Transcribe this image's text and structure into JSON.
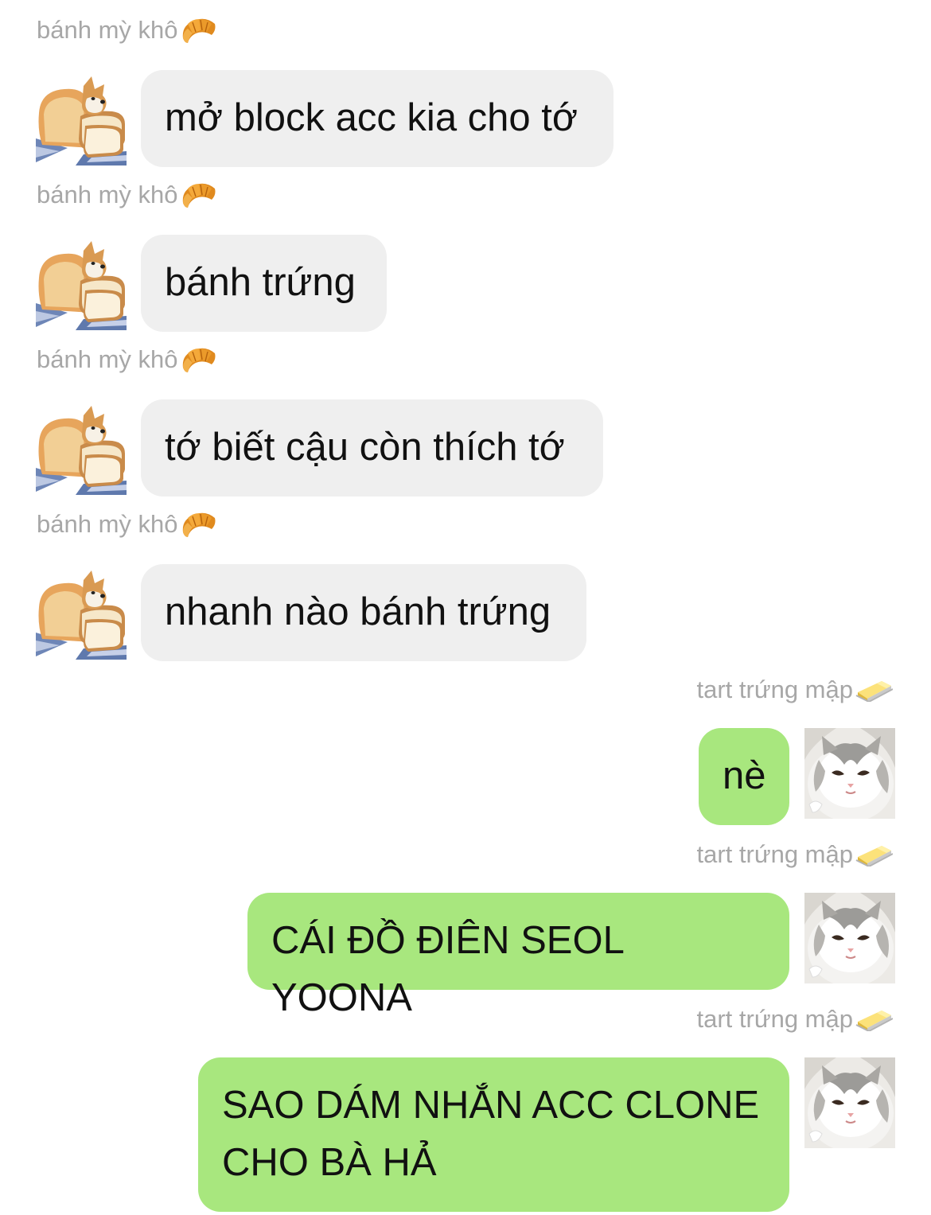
{
  "conversation": {
    "messages": [
      {
        "sender": "bánh mỳ khô",
        "sender_emoji": "croissant-icon",
        "text": "mở block acc kia cho tớ",
        "avatar": "bread-dog-avatar"
      },
      {
        "sender": "bánh mỳ khô",
        "sender_emoji": "croissant-icon",
        "text": "bánh trứng",
        "avatar": "bread-dog-avatar"
      },
      {
        "sender": "bánh mỳ khô",
        "sender_emoji": "croissant-icon",
        "text": "tớ biết cậu còn thích tớ",
        "avatar": "bread-dog-avatar"
      },
      {
        "sender": "bánh mỳ khô",
        "sender_emoji": "croissant-icon",
        "text": "nhanh nào bánh trứng",
        "avatar": "bread-dog-avatar"
      },
      {
        "sender": "tart trứng mập",
        "sender_emoji": "butter-icon",
        "text": "nè",
        "avatar": "white-cat-avatar"
      },
      {
        "sender": "tart trứng mập",
        "sender_emoji": "butter-icon",
        "text": "CÁI ĐỒ ĐIÊN SEOL YOONA",
        "avatar": "white-cat-avatar"
      },
      {
        "sender": "tart trứng mập",
        "sender_emoji": "butter-icon",
        "text": "SAO DÁM NHẮN ACC CLONE\nCHO BÀ HẢ",
        "avatar": "white-cat-avatar"
      }
    ]
  },
  "colors": {
    "incoming_bubble": "#efefef",
    "outgoing_bubble": "#a8e77e",
    "sender_name": "#a7a7a7",
    "message_text": "#111111"
  }
}
